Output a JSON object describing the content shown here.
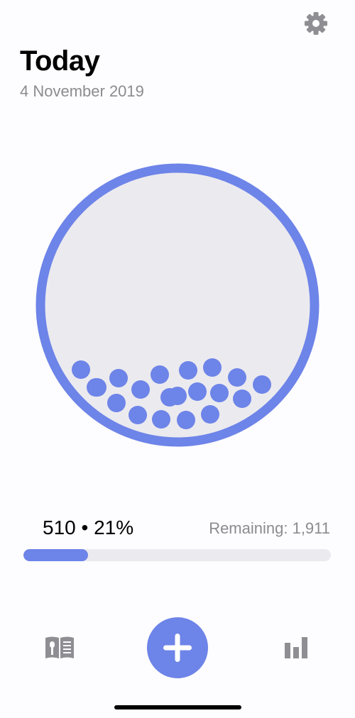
{
  "header": {
    "title": "Today",
    "date": "4 November 2019",
    "settings_icon": "gear-icon"
  },
  "summary": {
    "consumed_label": "510 • 21%",
    "consumed": 510,
    "percent": 21,
    "remaining_label": "Remaining: 1,911",
    "remaining": 1911
  },
  "progress": {
    "fraction": 0.21
  },
  "bowl": {
    "fill_level": 0.21,
    "ball_count": 20
  },
  "nav": {
    "left_icon": "log-book-icon",
    "center_icon": "plus-icon",
    "right_icon": "bar-chart-icon"
  },
  "colors": {
    "accent": "#6d84e8",
    "bowl_fill": "#ebeaef",
    "secondary_text": "#8b8b90",
    "nav_icon": "#8e8e93",
    "background": "#fdfcfe"
  }
}
